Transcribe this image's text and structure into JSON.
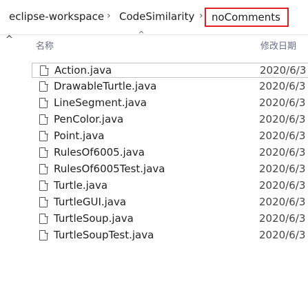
{
  "breadcrumb": {
    "items": [
      "eclipse-workspace",
      "CodeSimilarity",
      "noComments"
    ],
    "separator": "›",
    "current_highlight_color": "#e02020"
  },
  "columns": {
    "name": "名称",
    "modified": "修改日期"
  },
  "files": [
    {
      "name": "Action.java",
      "date": "2020/6/3"
    },
    {
      "name": "DrawableTurtle.java",
      "date": "2020/6/3"
    },
    {
      "name": "LineSegment.java",
      "date": "2020/6/3"
    },
    {
      "name": "PenColor.java",
      "date": "2020/6/3"
    },
    {
      "name": "Point.java",
      "date": "2020/6/3"
    },
    {
      "name": "RulesOf6005.java",
      "date": "2020/6/3"
    },
    {
      "name": "RulesOf6005Test.java",
      "date": "2020/6/3"
    },
    {
      "name": "Turtle.java",
      "date": "2020/6/3"
    },
    {
      "name": "TurtleGUI.java",
      "date": "2020/6/3"
    },
    {
      "name": "TurtleSoup.java",
      "date": "2020/6/3"
    },
    {
      "name": "TurtleSoupTest.java",
      "date": "2020/6/3"
    }
  ],
  "icons": {
    "file": "file-icon",
    "up": "up-caret-icon",
    "sort": "sort-ascending-icon"
  }
}
